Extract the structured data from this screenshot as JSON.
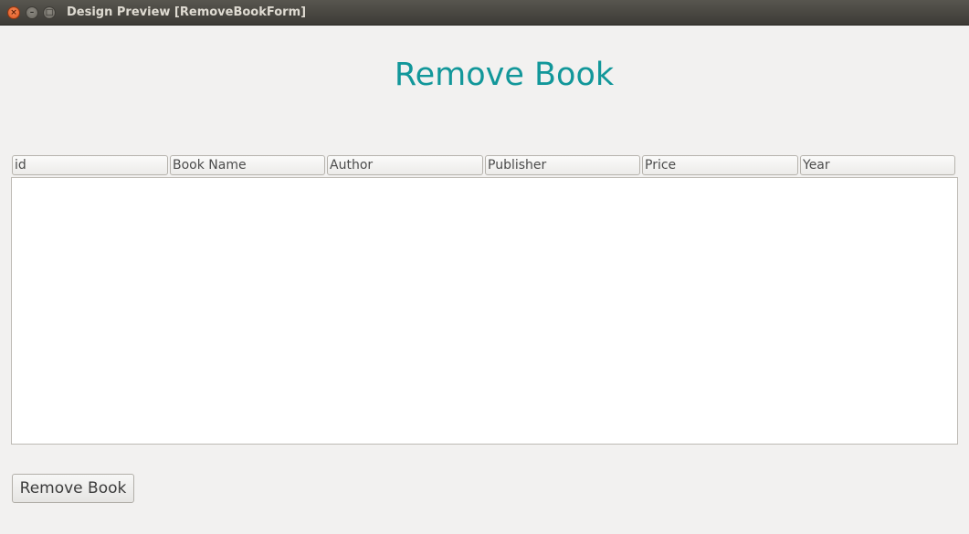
{
  "window": {
    "title": "Design Preview [RemoveBookForm]",
    "controls": {
      "close_glyph": "×",
      "minimize_glyph": "–",
      "maximize_glyph": "□"
    }
  },
  "form": {
    "heading": "Remove Book",
    "heading_color": "#12979a"
  },
  "table": {
    "columns": [
      "id",
      "Book Name",
      "Author",
      "Publisher",
      "Price",
      "Year"
    ],
    "rows": []
  },
  "actions": {
    "remove_label": "Remove Book"
  }
}
